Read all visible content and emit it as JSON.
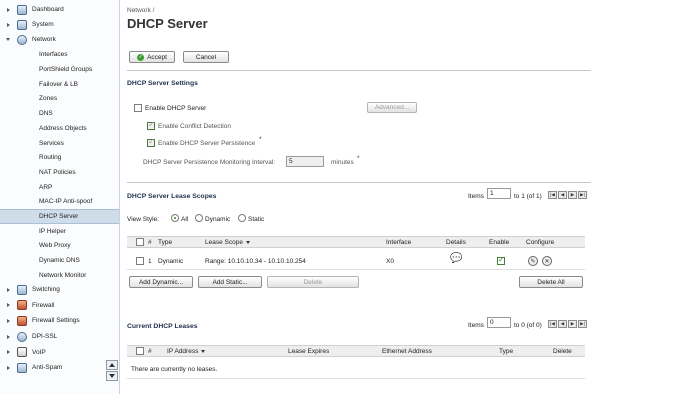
{
  "sidebar": {
    "top": [
      {
        "label": "Dashboard",
        "open": false
      },
      {
        "label": "System",
        "open": false
      },
      {
        "label": "Network",
        "open": true
      }
    ],
    "network_items": [
      "Interfaces",
      "PortShield Groups",
      "Failover & LB",
      "Zones",
      "DNS",
      "Address Objects",
      "Services",
      "Routing",
      "NAT Policies",
      "ARP",
      "MAC-IP Anti-spoof",
      "DHCP Server",
      "IP Helper",
      "Web Proxy",
      "Dynamic DNS",
      "Network Monitor"
    ],
    "active_item": "DHCP Server",
    "bottom": [
      {
        "label": "Switching"
      },
      {
        "label": "Firewall"
      },
      {
        "label": "Firewall Settings"
      },
      {
        "label": "DPI-SSL"
      },
      {
        "label": "VoIP"
      },
      {
        "label": "Anti-Spam"
      }
    ]
  },
  "breadcrumb": "Network /",
  "title": "DHCP Server",
  "toolbar": {
    "accept": "Accept",
    "cancel": "Cancel"
  },
  "settings": {
    "heading": "DHCP Server Settings",
    "enable_label": "Enable DHCP Server",
    "advanced": "Advanced...",
    "conflict_label": "Enable Conflict Detection",
    "persistence_label": "Enable DHCP Server Persistence",
    "asterisk": "*",
    "interval_label": "DHCP Server Persistence Monitoring Interval:",
    "interval_value": "5",
    "interval_unit": "minutes"
  },
  "scopes": {
    "heading": "DHCP Server Lease Scopes",
    "items_label": "Items",
    "page_value": "1",
    "range_text": "to 1 (of 1)",
    "view_style_label": "View Style:",
    "radio_all": "All",
    "radio_dynamic": "Dynamic",
    "radio_static": "Static",
    "columns": {
      "hash": "#",
      "type": "Type",
      "scope": "Lease Scope",
      "interface": "Interface",
      "details": "Details",
      "enable": "Enable",
      "configure": "Configure"
    },
    "rows": [
      {
        "num": "1",
        "type": "Dynamic",
        "scope": "Range: 10.10.10.34 - 10.10.10.254",
        "interface": "X0"
      }
    ],
    "add_dynamic": "Add Dynamic...",
    "add_static": "Add Static...",
    "delete": "Delete",
    "delete_all": "Delete All"
  },
  "leases": {
    "heading": "Current DHCP Leases",
    "items_label": "Items",
    "page_value": "0",
    "range_text": "to 0 (of 0)",
    "columns": {
      "hash": "#",
      "ip": "IP Address",
      "expires": "Lease Expires",
      "mac": "Ethernet Address",
      "type": "Type",
      "delete": "Delete"
    },
    "empty_text": "There are currently no leases."
  },
  "pager_glyphs": {
    "first": "|◀",
    "prev": "◀",
    "next": "▶",
    "last": "▶|"
  }
}
